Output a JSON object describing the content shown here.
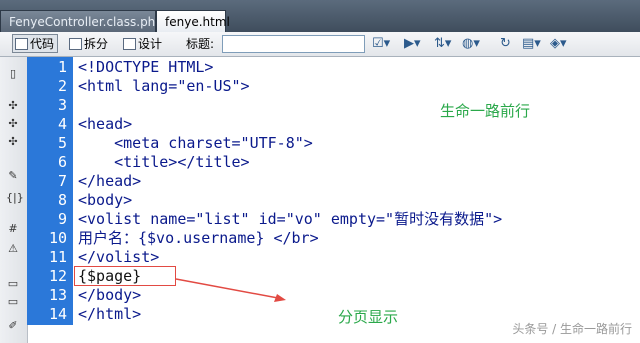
{
  "tabs": [
    {
      "label": "FenyeController.class.php",
      "active": false
    },
    {
      "label": "fenye.html",
      "active": true
    }
  ],
  "toolbar": {
    "code_label": "代码",
    "split_label": "拆分",
    "design_label": "设计",
    "title_label": "标题:",
    "title_value": ""
  },
  "line_numbers": [
    "1",
    "2",
    "3",
    "4",
    "5",
    "6",
    "7",
    "8",
    "9",
    "10",
    "11",
    "12",
    "13",
    "14"
  ],
  "code_lines": [
    "<!DOCTYPE HTML>",
    "<html lang=\"en-US\">",
    "",
    "<head>",
    "    <meta charset=\"UTF-8\">",
    "    <title></title>",
    "</head>",
    "<body>",
    "<volist name=\"list\" id=\"vo\" empty=\"暂时没有数据\">",
    "用户名：{$vo.username} </br>",
    "</volist>",
    "{$page}",
    "</body>",
    "</html>"
  ],
  "annotations": {
    "top_note": "生命一路前行",
    "page_note": "分页显示"
  },
  "watermark": "头条号 / 生命一路前行",
  "colors": {
    "gutter": "#2b78d9",
    "code_text": "#0b1a8c",
    "annotation": "#2aa84a",
    "highlight_box": "#e24a43"
  },
  "icons": [
    "code-view-icon",
    "split-view-icon",
    "design-view-icon",
    "validate-icon",
    "preview-icon",
    "file-manage-icon",
    "globe-icon",
    "refresh-icon",
    "view-options-icon",
    "visual-aids-icon"
  ]
}
